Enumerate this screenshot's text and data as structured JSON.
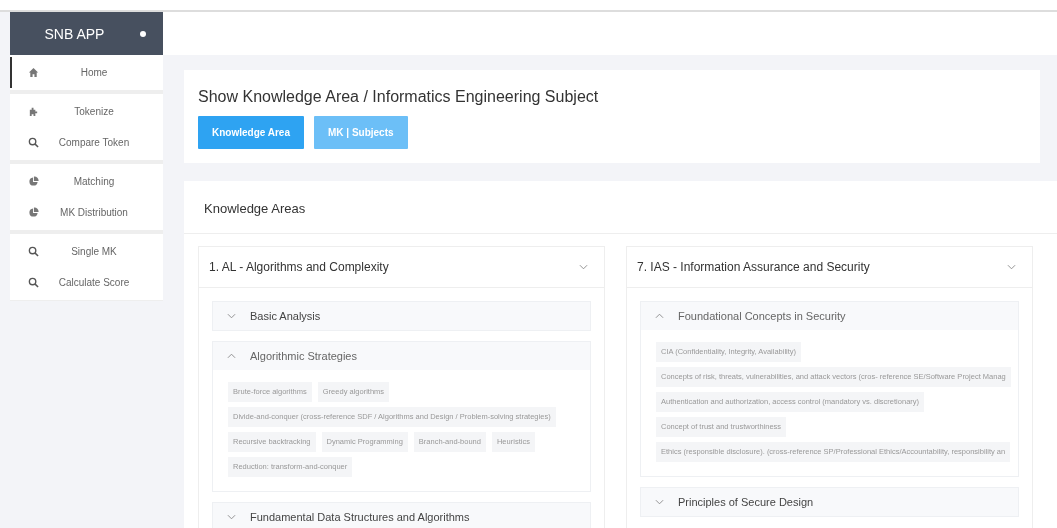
{
  "sidebar": {
    "title": "SNB APP",
    "sections": [
      {
        "items": [
          {
            "label": "Home",
            "kind": "home",
            "selected": true
          }
        ]
      },
      {
        "items": [
          {
            "label": "Tokenize",
            "kind": "puzzle",
            "selected": false
          },
          {
            "label": "Compare Token",
            "kind": "search",
            "selected": false
          }
        ]
      },
      {
        "items": [
          {
            "label": "Matching",
            "kind": "pie",
            "selected": false
          },
          {
            "label": "MK Distribution",
            "kind": "pie",
            "selected": false
          }
        ]
      },
      {
        "items": [
          {
            "label": "Single MK",
            "kind": "search",
            "selected": false
          },
          {
            "label": "Calculate Score",
            "kind": "search",
            "selected": false
          }
        ]
      }
    ]
  },
  "header": {
    "title": "Show Knowledge Area / Informatics Engineering Subject",
    "buttons": [
      {
        "label": "Knowledge Area",
        "selected": true
      },
      {
        "label": "MK | Subjects",
        "selected": false
      }
    ]
  },
  "knowledge_areas": {
    "title": "Knowledge Areas",
    "areas": [
      {
        "title": "1. AL - Algorithms and Complexity",
        "units": [
          {
            "title": "Basic Analysis",
            "expanded": false
          },
          {
            "title": "Algorithmic Strategies",
            "expanded": true,
            "topics": [
              "Brute-force algorithms",
              "Greedy algorithms",
              "Divide-and-conquer (cross-reference SDF / Algorithms and Design / Problem-solving strategies)",
              "Recursive backtracking",
              "Dynamic Programming",
              "Branch-and-bound",
              "Heuristics",
              "Reduction: transform-and-conquer"
            ]
          },
          {
            "title": "Fundamental Data Structures and Algorithms",
            "expanded": false
          }
        ]
      },
      {
        "title": "7. IAS - Information Assurance and Security",
        "units": [
          {
            "title": "Foundational Concepts in Security",
            "expanded": true,
            "topics": [
              "CIA (Confidentiality, Integrity, Availability)",
              "Concepts of risk, threats, vulnerabilities, and attack vectors (cros- reference SE/Software Project Manag",
              "Authentication and authorization, access control (mandatory vs. discretionary)",
              "Concept of trust and trustworthiness",
              "Ethics (responsible disclosure). (cross-reference SP/Professional Ethics/Accountability, responsibility an"
            ]
          },
          {
            "title": "Principles of Secure Design",
            "expanded": false
          }
        ]
      }
    ]
  }
}
